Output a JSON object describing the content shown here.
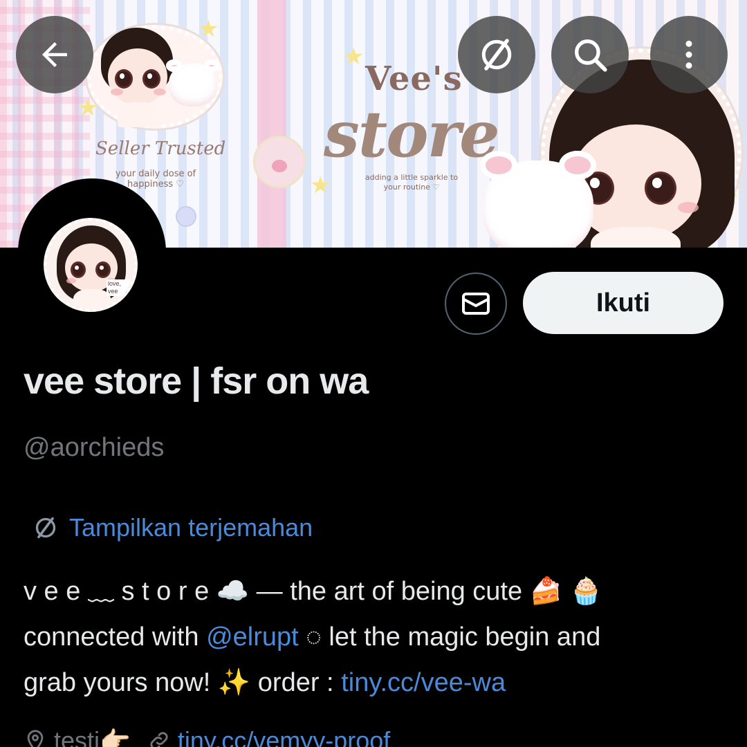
{
  "banner": {
    "title_line1": "Vee's",
    "title_line2": "store",
    "tagline": "adding a little sparkle to your routine ♡",
    "seller_text": "Seller Trusted",
    "daily_text": "your daily dose of happiness ♡"
  },
  "toolbar": {
    "back_icon": "arrow-left-icon",
    "translate_icon": "translate-icon",
    "search_icon": "search-icon",
    "more_icon": "more-vertical-icon"
  },
  "profile": {
    "display_name": "vee store | fsr on wa",
    "handle": "@aorchieds",
    "follow_label": "Ikuti",
    "message_icon": "mail-icon",
    "translate_label": "Tampilkan terjemahan",
    "avatar_caption": "love, vee"
  },
  "bio": {
    "part1": "v e e ﹏ s t o r e ☁️ — the art of being cute 🍰 🧁",
    "part2_prefix": "connected with ",
    "mention": "@elrupt",
    "part2_suffix": " ◌ let the magic begin and",
    "part3_prefix": "grab yours now! ✨ order : ",
    "order_link": "tiny.cc/vee-wa"
  },
  "meta": {
    "location": "testi👉🏻",
    "url": "tiny.cc/vemyy-proof"
  },
  "colors": {
    "link": "#4a8ad8",
    "secondary_text": "#71767b",
    "background": "#000000",
    "follow_bg": "#eff3f4"
  }
}
